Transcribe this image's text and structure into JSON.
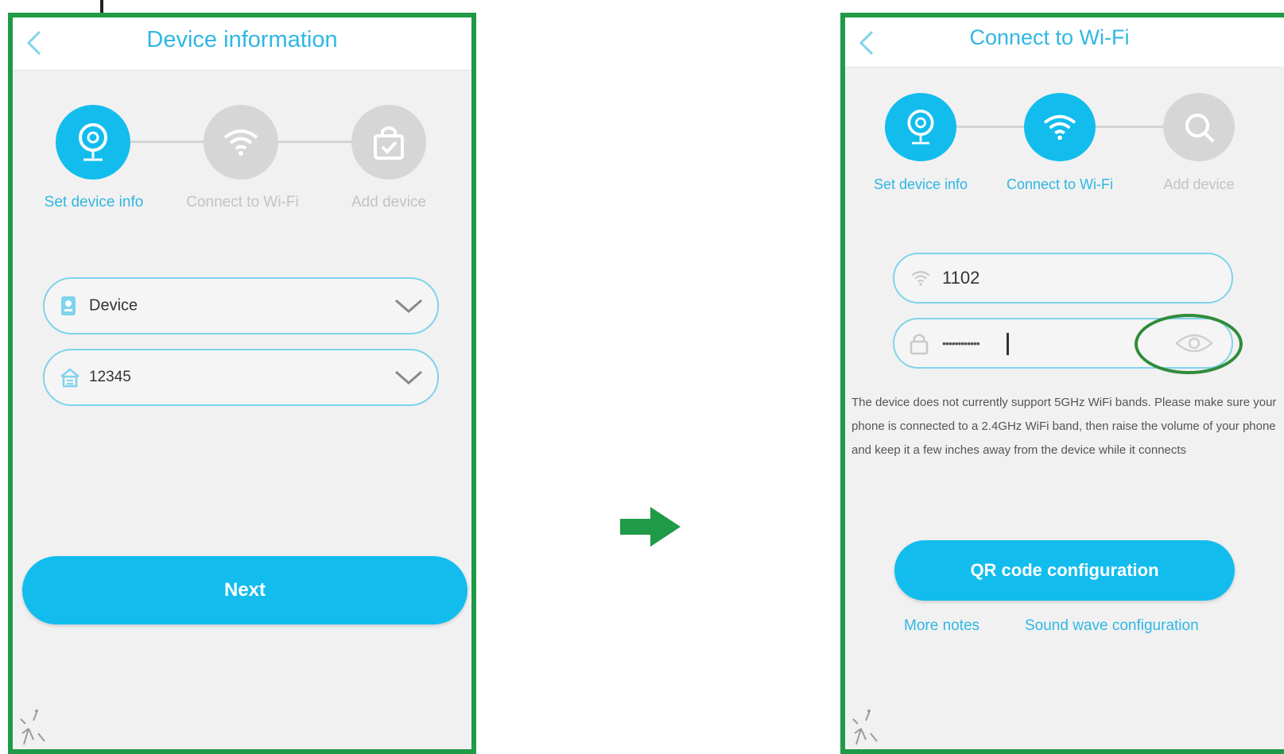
{
  "screen1": {
    "title": "Device information",
    "steps": [
      {
        "label": "Set device info",
        "icon": "camera-icon",
        "state": "active"
      },
      {
        "label": "Connect to Wi-Fi",
        "icon": "wifi-icon",
        "state": "inactive"
      },
      {
        "label": "Add device",
        "icon": "bag-check-icon",
        "state": "inactive"
      }
    ],
    "device_field": {
      "value": "Device",
      "icon": "device-icon"
    },
    "room_field": {
      "value": "12345",
      "icon": "house-icon"
    },
    "next_label": "Next"
  },
  "screen2": {
    "title": "Connect to Wi-Fi",
    "steps": [
      {
        "label": "Set device info",
        "icon": "camera-icon",
        "state": "active"
      },
      {
        "label": "Connect to Wi-Fi",
        "icon": "wifi-icon",
        "state": "active"
      },
      {
        "label": "Add device",
        "icon": "search-icon",
        "state": "inactive"
      }
    ],
    "ssid_field": {
      "value": "1102",
      "icon": "wifi-icon"
    },
    "password_field": {
      "value": "••••••••••••",
      "icon": "lock-icon"
    },
    "notice": "The device does not currently support 5GHz WiFi bands. Please make sure your phone is connected to a 2.4GHz WiFi band, then raise the volume of your phone and keep it a few inches away from the device while it connects",
    "qr_button": "QR code configuration",
    "more_notes": "More notes",
    "sound_wave": "Sound wave configuration"
  },
  "colors": {
    "accent": "#12bdee",
    "title": "#2fb7e3",
    "frame": "#1f9a47",
    "inactive": "#d6d6d6"
  }
}
